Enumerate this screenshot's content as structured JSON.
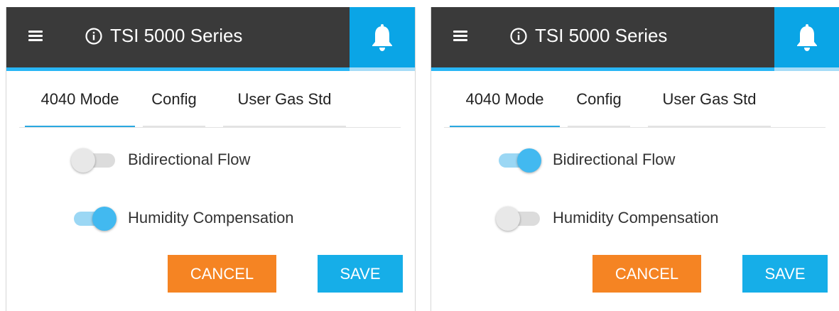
{
  "colors": {
    "header_bg": "#3a3a3a",
    "accent": "#29b6f6",
    "bell_bg": "#0aa5e6",
    "cancel": "#f58423",
    "save": "#16aee8",
    "toggle_on": "#42b9f0"
  },
  "icons": {
    "menu": "hamburger-menu-icon",
    "info": "info-circle-icon",
    "notifications": "bell-icon"
  },
  "panels": [
    {
      "header": {
        "title": "TSI 5000 Series"
      },
      "tabs": [
        {
          "label": "4040 Mode",
          "active": true
        },
        {
          "label": "Config",
          "active": false
        },
        {
          "label": "User Gas Std",
          "active": false
        }
      ],
      "toggles": [
        {
          "label": "Bidirectional Flow",
          "on": false
        },
        {
          "label": "Humidity Compensation",
          "on": true
        }
      ],
      "buttons": {
        "cancel": "CANCEL",
        "save": "SAVE"
      }
    },
    {
      "header": {
        "title": "TSI 5000 Series"
      },
      "tabs": [
        {
          "label": "4040 Mode",
          "active": true
        },
        {
          "label": "Config",
          "active": false
        },
        {
          "label": "User Gas Std",
          "active": false
        }
      ],
      "toggles": [
        {
          "label": "Bidirectional Flow",
          "on": true
        },
        {
          "label": "Humidity Compensation",
          "on": false
        }
      ],
      "buttons": {
        "cancel": "CANCEL",
        "save": "SAVE"
      }
    }
  ]
}
